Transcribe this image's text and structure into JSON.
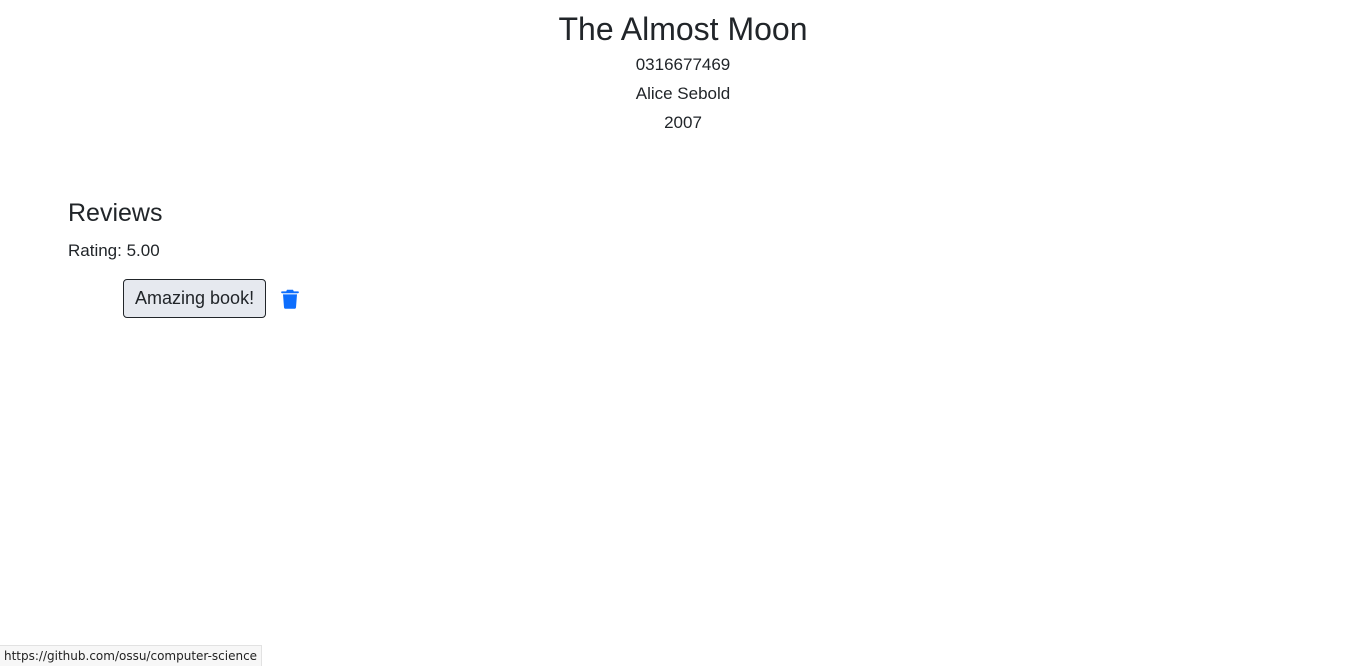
{
  "book": {
    "title": "The Almost Moon",
    "isbn": "0316677469",
    "author": "Alice Sebold",
    "year": "2007"
  },
  "reviews": {
    "heading": "Reviews",
    "rating_label": "Rating: 5.00",
    "items": [
      {
        "text": "Amazing book!",
        "delete_icon": "trash-icon"
      }
    ]
  },
  "status_bar": {
    "url": "https://github.com/ossu/computer-science"
  },
  "colors": {
    "text": "#212529",
    "accent": "#0d6efd",
    "chip_background": "#e6e9ef"
  }
}
